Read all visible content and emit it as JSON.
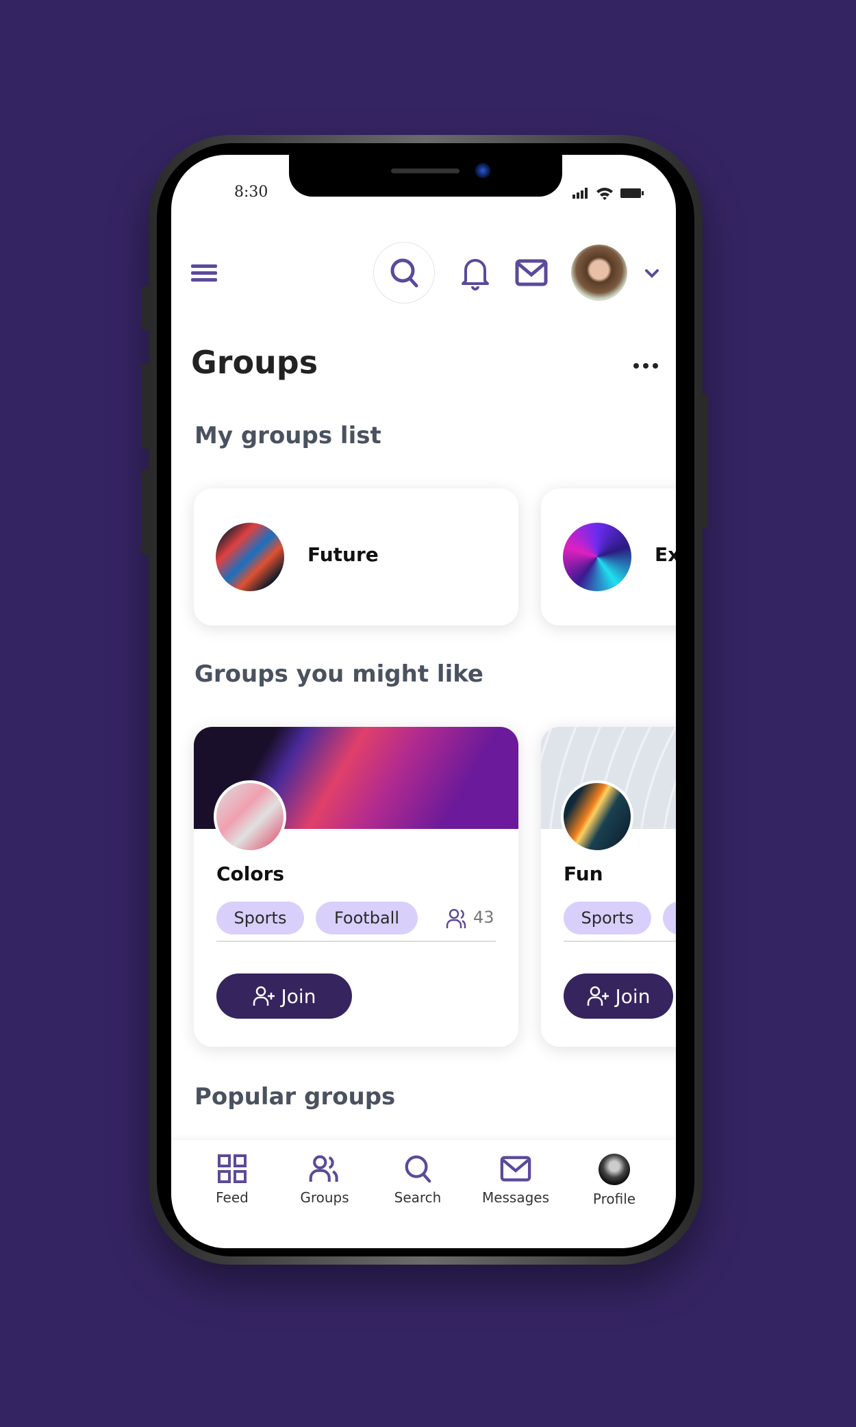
{
  "status_bar": {
    "time": "8:30"
  },
  "header": {
    "menu_icon": "hamburger-icon",
    "search_icon": "search-icon",
    "notifications_icon": "bell-icon",
    "messages_icon": "mail-icon",
    "avatar": "user-avatar",
    "dropdown_icon": "chevron-down-icon"
  },
  "page": {
    "title": "Groups",
    "more_icon": "more-horizontal-icon"
  },
  "my_groups": {
    "heading": "My groups list",
    "items": [
      {
        "name": "Future"
      },
      {
        "name": "Ex"
      }
    ]
  },
  "suggested": {
    "heading": "Groups you might like",
    "join_label": "Join",
    "items": [
      {
        "name": "Colors",
        "tags": [
          "Sports",
          "Football"
        ],
        "members": "43"
      },
      {
        "name": "Fun",
        "tags": [
          "Sports"
        ]
      }
    ]
  },
  "popular": {
    "heading": "Popular groups"
  },
  "bottom_nav": {
    "items": [
      {
        "label": "Feed",
        "icon": "grid-icon"
      },
      {
        "label": "Groups",
        "icon": "users-icon"
      },
      {
        "label": "Search",
        "icon": "search-icon"
      },
      {
        "label": "Messages",
        "icon": "mail-icon"
      },
      {
        "label": "Profile",
        "icon": "profile-avatar"
      }
    ]
  },
  "colors": {
    "background": "#352462",
    "accent": "#5b4a9a",
    "button": "#36245f",
    "chip": "#d9cffb"
  }
}
